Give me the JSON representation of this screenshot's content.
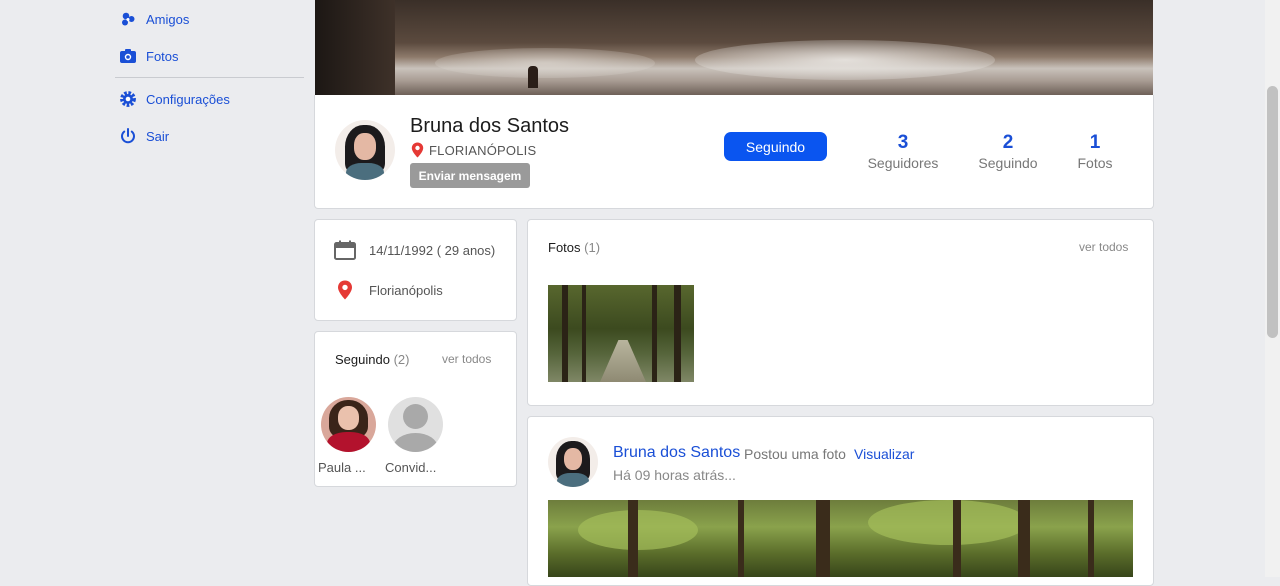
{
  "sidebar": {
    "items": [
      {
        "label": "Amigos",
        "icon": "friends-icon"
      },
      {
        "label": "Fotos",
        "icon": "camera-icon"
      },
      {
        "label": "Configurações",
        "icon": "gear-icon"
      },
      {
        "label": "Sair",
        "icon": "power-icon"
      }
    ]
  },
  "profile": {
    "name": "Bruna dos Santos",
    "city": "FLORIANÓPOLIS",
    "message_button": "Enviar mensagem",
    "follow_button": "Seguindo",
    "stats": [
      {
        "value": "3",
        "label": "Seguidores"
      },
      {
        "value": "2",
        "label": "Seguindo"
      },
      {
        "value": "1",
        "label": "Fotos"
      }
    ]
  },
  "info": {
    "birthday": "14/11/1992 ( 29 anos)",
    "location": "Florianópolis"
  },
  "following": {
    "title": "Seguindo",
    "count": "(2)",
    "see_all": "ver todos",
    "people": [
      {
        "name": "Paula ..."
      },
      {
        "name": "Convid..."
      }
    ]
  },
  "photos": {
    "title": "Fotos",
    "count": "(1)",
    "see_all": "ver todos"
  },
  "post": {
    "author": "Bruna dos Santos",
    "action": "Postou uma foto",
    "view_link": "Visualizar",
    "time": "Há 09 horas atrás..."
  },
  "colors": {
    "accent": "#1a4fd6",
    "follow_button": "#0a55f0",
    "message_button": "#9a9a9a",
    "pin": "#e53935",
    "background": "#ebecef"
  }
}
